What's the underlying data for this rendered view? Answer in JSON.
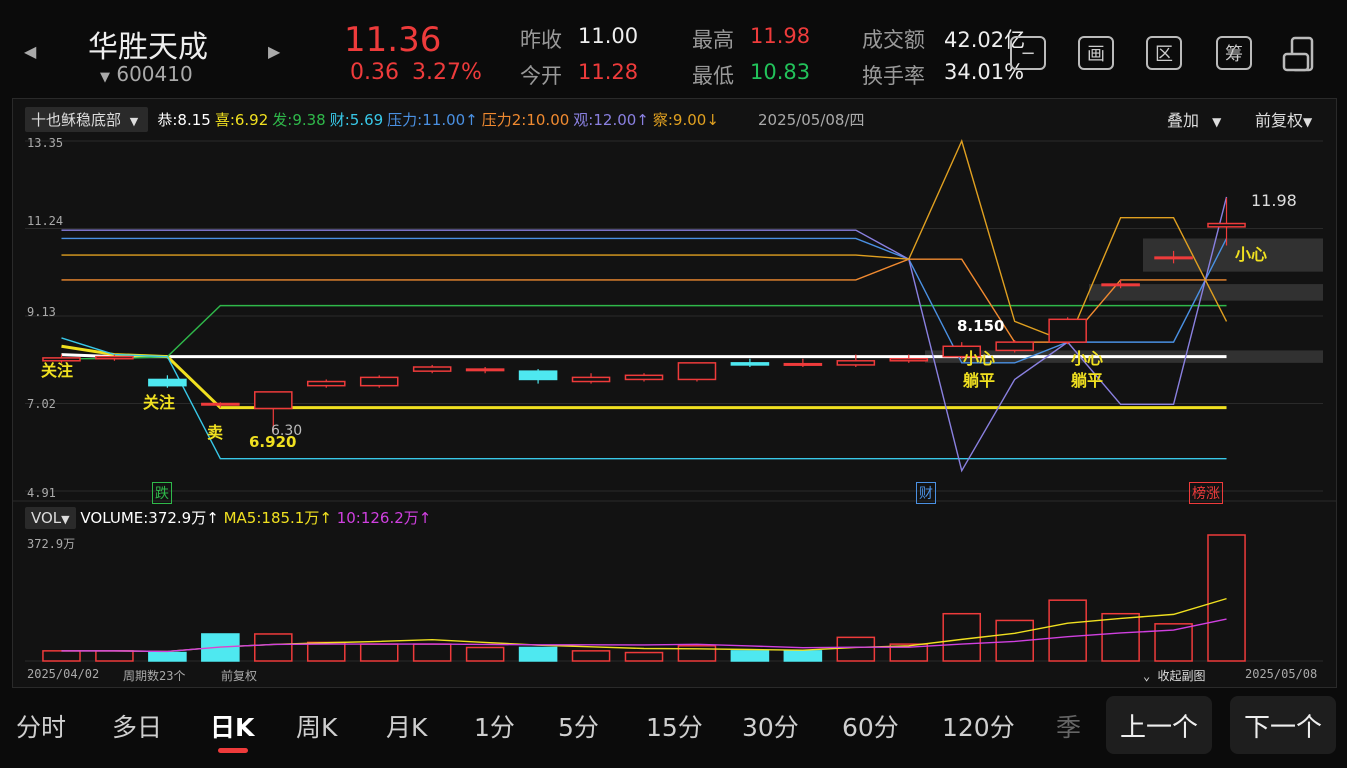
{
  "header": {
    "stock_name": "华胜天成",
    "stock_code": "600410",
    "price": "11.36",
    "change": "0.36",
    "change_pct": "3.27%",
    "prev_close_label": "昨收",
    "prev_close": "11.00",
    "open_label": "今开",
    "open": "11.28",
    "high_label": "最高",
    "high": "11.98",
    "low_label": "最低",
    "low": "10.83",
    "turnover_amt_label": "成交额",
    "turnover_amt": "42.02亿",
    "turnover_rate_label": "换手率",
    "turnover_rate": "34.01%",
    "icons": {
      "minus": "−",
      "画": "画",
      "区": "区",
      "筹": "筹"
    }
  },
  "indicator": {
    "name": "十也稣稳底部",
    "items": [
      {
        "label": "恭:",
        "value": "8.15",
        "color": "#ffffff"
      },
      {
        "label": "喜:",
        "value": "6.92",
        "color": "#f0e020"
      },
      {
        "label": "发:",
        "value": "9.38",
        "color": "#2fb84a"
      },
      {
        "label": "财:",
        "value": "5.69",
        "color": "#38c8e8"
      },
      {
        "label": "压力:",
        "value": "11.00↑",
        "color": "#4a90e2"
      },
      {
        "label": "压力2:",
        "value": "10.00",
        "color": "#f08a30"
      },
      {
        "label": "观:",
        "value": "12.00↑",
        "color": "#8a80e0"
      },
      {
        "label": "察:",
        "value": "9.00↓",
        "color": "#e0a020"
      }
    ],
    "date": "2025/05/08/四",
    "overlay": "叠加",
    "adjust": "前复权"
  },
  "axis": {
    "y_ticks": [
      "13.35",
      "11.24",
      "9.13",
      "7.02",
      "4.91"
    ],
    "vol_tick": "372.9万",
    "date_start": "2025/04/02",
    "period_count": "周期数23个",
    "adjust": "前复权",
    "collapse": "收起副图",
    "date_end": "2025/05/08"
  },
  "annotations": {
    "guanzhu1": "关注",
    "guanzhu2": "关注",
    "mai": "卖",
    "low_val": "6.920",
    "low2": "6.30",
    "high_mark": "11.98",
    "val_8150": "8.150",
    "xiaoxin1": "小心",
    "tangping1": "躺平",
    "xiaoxin2": "小心",
    "tangping2": "躺平",
    "xiaoxin3": "小心",
    "die": "跌",
    "cai": "财",
    "bangzhang": "榜涨"
  },
  "volume": {
    "name": "VOL",
    "line": "VOLUME:372.9万↑",
    "ma5": "MA5:185.1万↑",
    "ma10": "10:126.2万↑"
  },
  "tabs": [
    "分时",
    "多日",
    "日K",
    "周K",
    "月K",
    "1分",
    "5分",
    "15分",
    "30分",
    "60分",
    "120分",
    "季"
  ],
  "active_tab": "日K",
  "nav": {
    "prev": "上一个",
    "next": "下一个"
  },
  "chart_data": {
    "type": "candlestick",
    "ylim": [
      4.91,
      13.35
    ],
    "candles": [
      {
        "o": 8.05,
        "c": 8.12,
        "h": 8.2,
        "l": 8.0,
        "up": true
      },
      {
        "o": 8.1,
        "c": 8.15,
        "h": 8.2,
        "l": 8.05,
        "up": true
      },
      {
        "o": 7.6,
        "c": 7.45,
        "h": 7.7,
        "l": 7.4,
        "up": false
      },
      {
        "o": 7.0,
        "c": 7.02,
        "h": 7.05,
        "l": 6.92,
        "up": true
      },
      {
        "o": 6.9,
        "c": 7.3,
        "h": 7.3,
        "l": 6.3,
        "up": true
      },
      {
        "o": 7.45,
        "c": 7.55,
        "h": 7.6,
        "l": 7.4,
        "up": true
      },
      {
        "o": 7.45,
        "c": 7.65,
        "h": 7.7,
        "l": 7.4,
        "up": true
      },
      {
        "o": 7.8,
        "c": 7.9,
        "h": 7.95,
        "l": 7.75,
        "up": true
      },
      {
        "o": 7.85,
        "c": 7.85,
        "h": 7.9,
        "l": 7.75,
        "up": true
      },
      {
        "o": 7.8,
        "c": 7.6,
        "h": 7.85,
        "l": 7.5,
        "up": false
      },
      {
        "o": 7.55,
        "c": 7.65,
        "h": 7.75,
        "l": 7.5,
        "up": true
      },
      {
        "o": 7.6,
        "c": 7.7,
        "h": 7.75,
        "l": 7.55,
        "up": true
      },
      {
        "o": 7.6,
        "c": 8.0,
        "h": 8.0,
        "l": 7.55,
        "up": true
      },
      {
        "o": 8.0,
        "c": 7.95,
        "h": 8.1,
        "l": 7.9,
        "up": false
      },
      {
        "o": 7.98,
        "c": 7.98,
        "h": 8.1,
        "l": 7.9,
        "up": true
      },
      {
        "o": 7.95,
        "c": 8.05,
        "h": 8.2,
        "l": 7.9,
        "up": true
      },
      {
        "o": 8.05,
        "c": 8.1,
        "h": 8.2,
        "l": 8.0,
        "up": true
      },
      {
        "o": 8.15,
        "c": 8.4,
        "h": 8.5,
        "l": 8.1,
        "up": true
      },
      {
        "o": 8.3,
        "c": 8.5,
        "h": 8.55,
        "l": 8.25,
        "up": true
      },
      {
        "o": 8.5,
        "c": 9.05,
        "h": 9.1,
        "l": 8.45,
        "up": true
      },
      {
        "o": 9.9,
        "c": 9.9,
        "h": 10.0,
        "l": 9.8,
        "up": true
      },
      {
        "o": 10.55,
        "c": 10.55,
        "h": 10.7,
        "l": 10.4,
        "up": true
      },
      {
        "o": 11.28,
        "c": 11.36,
        "h": 11.98,
        "l": 10.83,
        "up": true
      }
    ],
    "volumes": [
      30,
      30,
      25,
      80,
      80,
      55,
      50,
      50,
      40,
      40,
      30,
      25,
      45,
      30,
      30,
      70,
      50,
      140,
      120,
      180,
      140,
      110,
      372.9
    ],
    "vol_up": [
      true,
      true,
      false,
      false,
      true,
      true,
      true,
      true,
      true,
      false,
      true,
      true,
      true,
      false,
      false,
      true,
      true,
      true,
      true,
      true,
      true,
      true,
      true
    ],
    "lines": [
      {
        "name": "恭",
        "color": "#ffffff",
        "values": [
          8.2,
          8.15,
          8.15,
          8.15,
          8.15,
          8.15,
          8.15,
          8.15,
          8.15,
          8.15,
          8.15,
          8.15,
          8.15,
          8.15,
          8.15,
          8.15,
          8.15,
          8.15,
          8.15,
          8.15,
          8.15,
          8.15,
          8.15
        ]
      },
      {
        "name": "喜",
        "color": "#f0e020",
        "values": [
          8.4,
          8.2,
          8.15,
          6.92,
          6.92,
          6.92,
          6.92,
          6.92,
          6.92,
          6.92,
          6.92,
          6.92,
          6.92,
          6.92,
          6.92,
          6.92,
          6.92,
          6.92,
          6.92,
          6.92,
          6.92,
          6.92,
          6.92
        ]
      },
      {
        "name": "发",
        "color": "#2fb84a",
        "values": [
          8.1,
          8.1,
          8.15,
          9.38,
          9.38,
          9.38,
          9.38,
          9.38,
          9.38,
          9.38,
          9.38,
          9.38,
          9.38,
          9.38,
          9.38,
          9.38,
          9.38,
          9.38,
          9.38,
          9.38,
          9.38,
          9.38,
          9.38
        ]
      },
      {
        "name": "财",
        "color": "#38c8e8",
        "values": [
          8.6,
          8.2,
          8.15,
          5.69,
          5.69,
          5.69,
          5.69,
          5.69,
          5.69,
          5.69,
          5.69,
          5.69,
          5.69,
          5.69,
          5.69,
          5.69,
          5.69,
          5.69,
          5.69,
          5.69,
          5.69,
          5.69,
          5.69
        ]
      },
      {
        "name": "压力",
        "color": "#4a90e2",
        "values": [
          11.0,
          11.0,
          11.0,
          11.0,
          11.0,
          11.0,
          11.0,
          11.0,
          11.0,
          11.0,
          11.0,
          11.0,
          11.0,
          11.0,
          11.0,
          11.0,
          10.5,
          8.0,
          8.0,
          8.5,
          8.5,
          8.5,
          11.0
        ]
      },
      {
        "name": "压力2",
        "color": "#f08a30",
        "values": [
          10.0,
          10.0,
          10.0,
          10.0,
          10.0,
          10.0,
          10.0,
          10.0,
          10.0,
          10.0,
          10.0,
          10.0,
          10.0,
          10.0,
          10.0,
          10.0,
          10.5,
          10.5,
          8.5,
          8.5,
          10.0,
          10.0,
          10.0
        ]
      },
      {
        "name": "观",
        "color": "#8a80e0",
        "values": [
          11.2,
          11.2,
          11.2,
          11.2,
          11.2,
          11.2,
          11.2,
          11.2,
          11.2,
          11.2,
          11.2,
          11.2,
          11.2,
          11.2,
          11.2,
          11.2,
          10.5,
          5.4,
          7.6,
          8.5,
          7.0,
          7.0,
          12.0
        ]
      },
      {
        "name": "察",
        "color": "#e0a020",
        "values": [
          10.6,
          10.6,
          10.6,
          10.6,
          10.6,
          10.6,
          10.6,
          10.6,
          10.6,
          10.6,
          10.6,
          10.6,
          10.6,
          10.6,
          10.6,
          10.6,
          10.5,
          13.35,
          9.0,
          8.5,
          11.5,
          11.5,
          9.0
        ]
      }
    ]
  }
}
